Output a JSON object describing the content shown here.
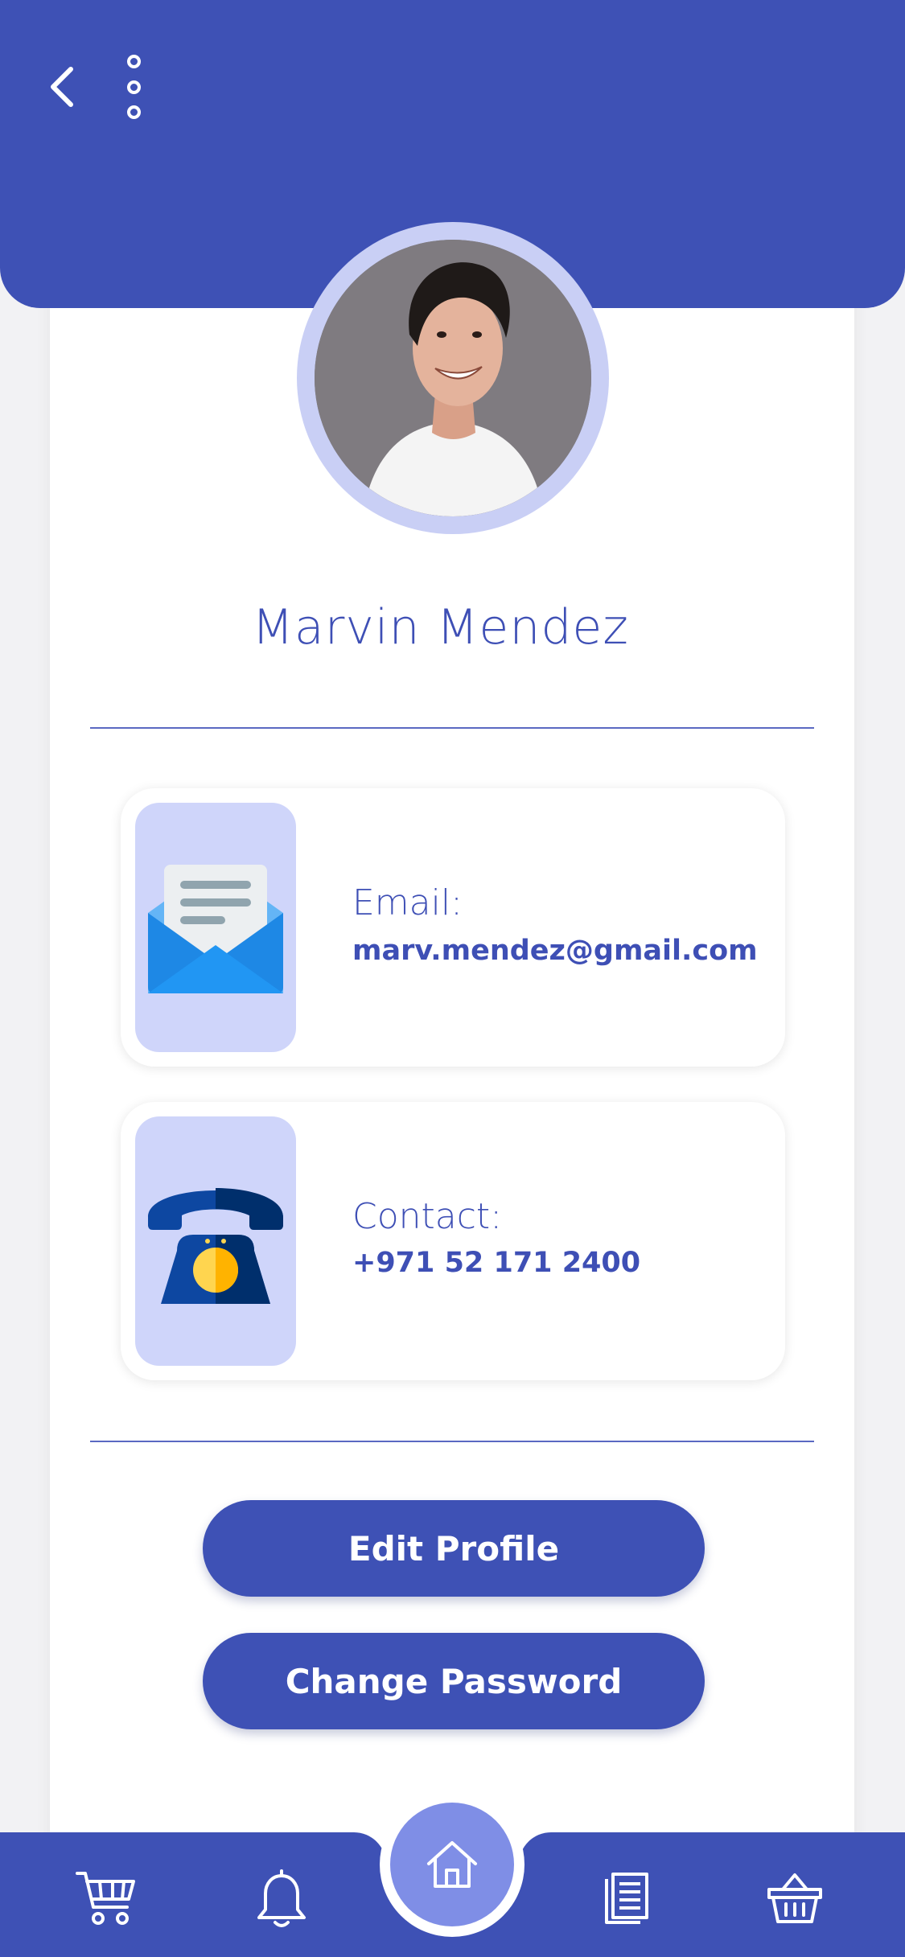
{
  "header": {
    "back_icon": "chevron-left-icon",
    "menu_icon": "more-vertical-icon"
  },
  "profile": {
    "name": "Marvin Mendez"
  },
  "email_card": {
    "label": "Email:",
    "value": "marv.mendez@gmail.com",
    "icon": "envelope-icon"
  },
  "contact_card": {
    "label": "Contact:",
    "value": "+971 52 171 2400",
    "icon": "telephone-icon"
  },
  "buttons": {
    "edit_profile": "Edit Profile",
    "change_password": "Change Password"
  },
  "bottom_nav": {
    "items": [
      "cart-icon",
      "bell-icon",
      "home-icon",
      "document-icon",
      "basket-icon"
    ]
  },
  "colors": {
    "primary": "#3e51b5",
    "accent_light": "#cfd5fa",
    "home_button": "#7f8ee6"
  }
}
